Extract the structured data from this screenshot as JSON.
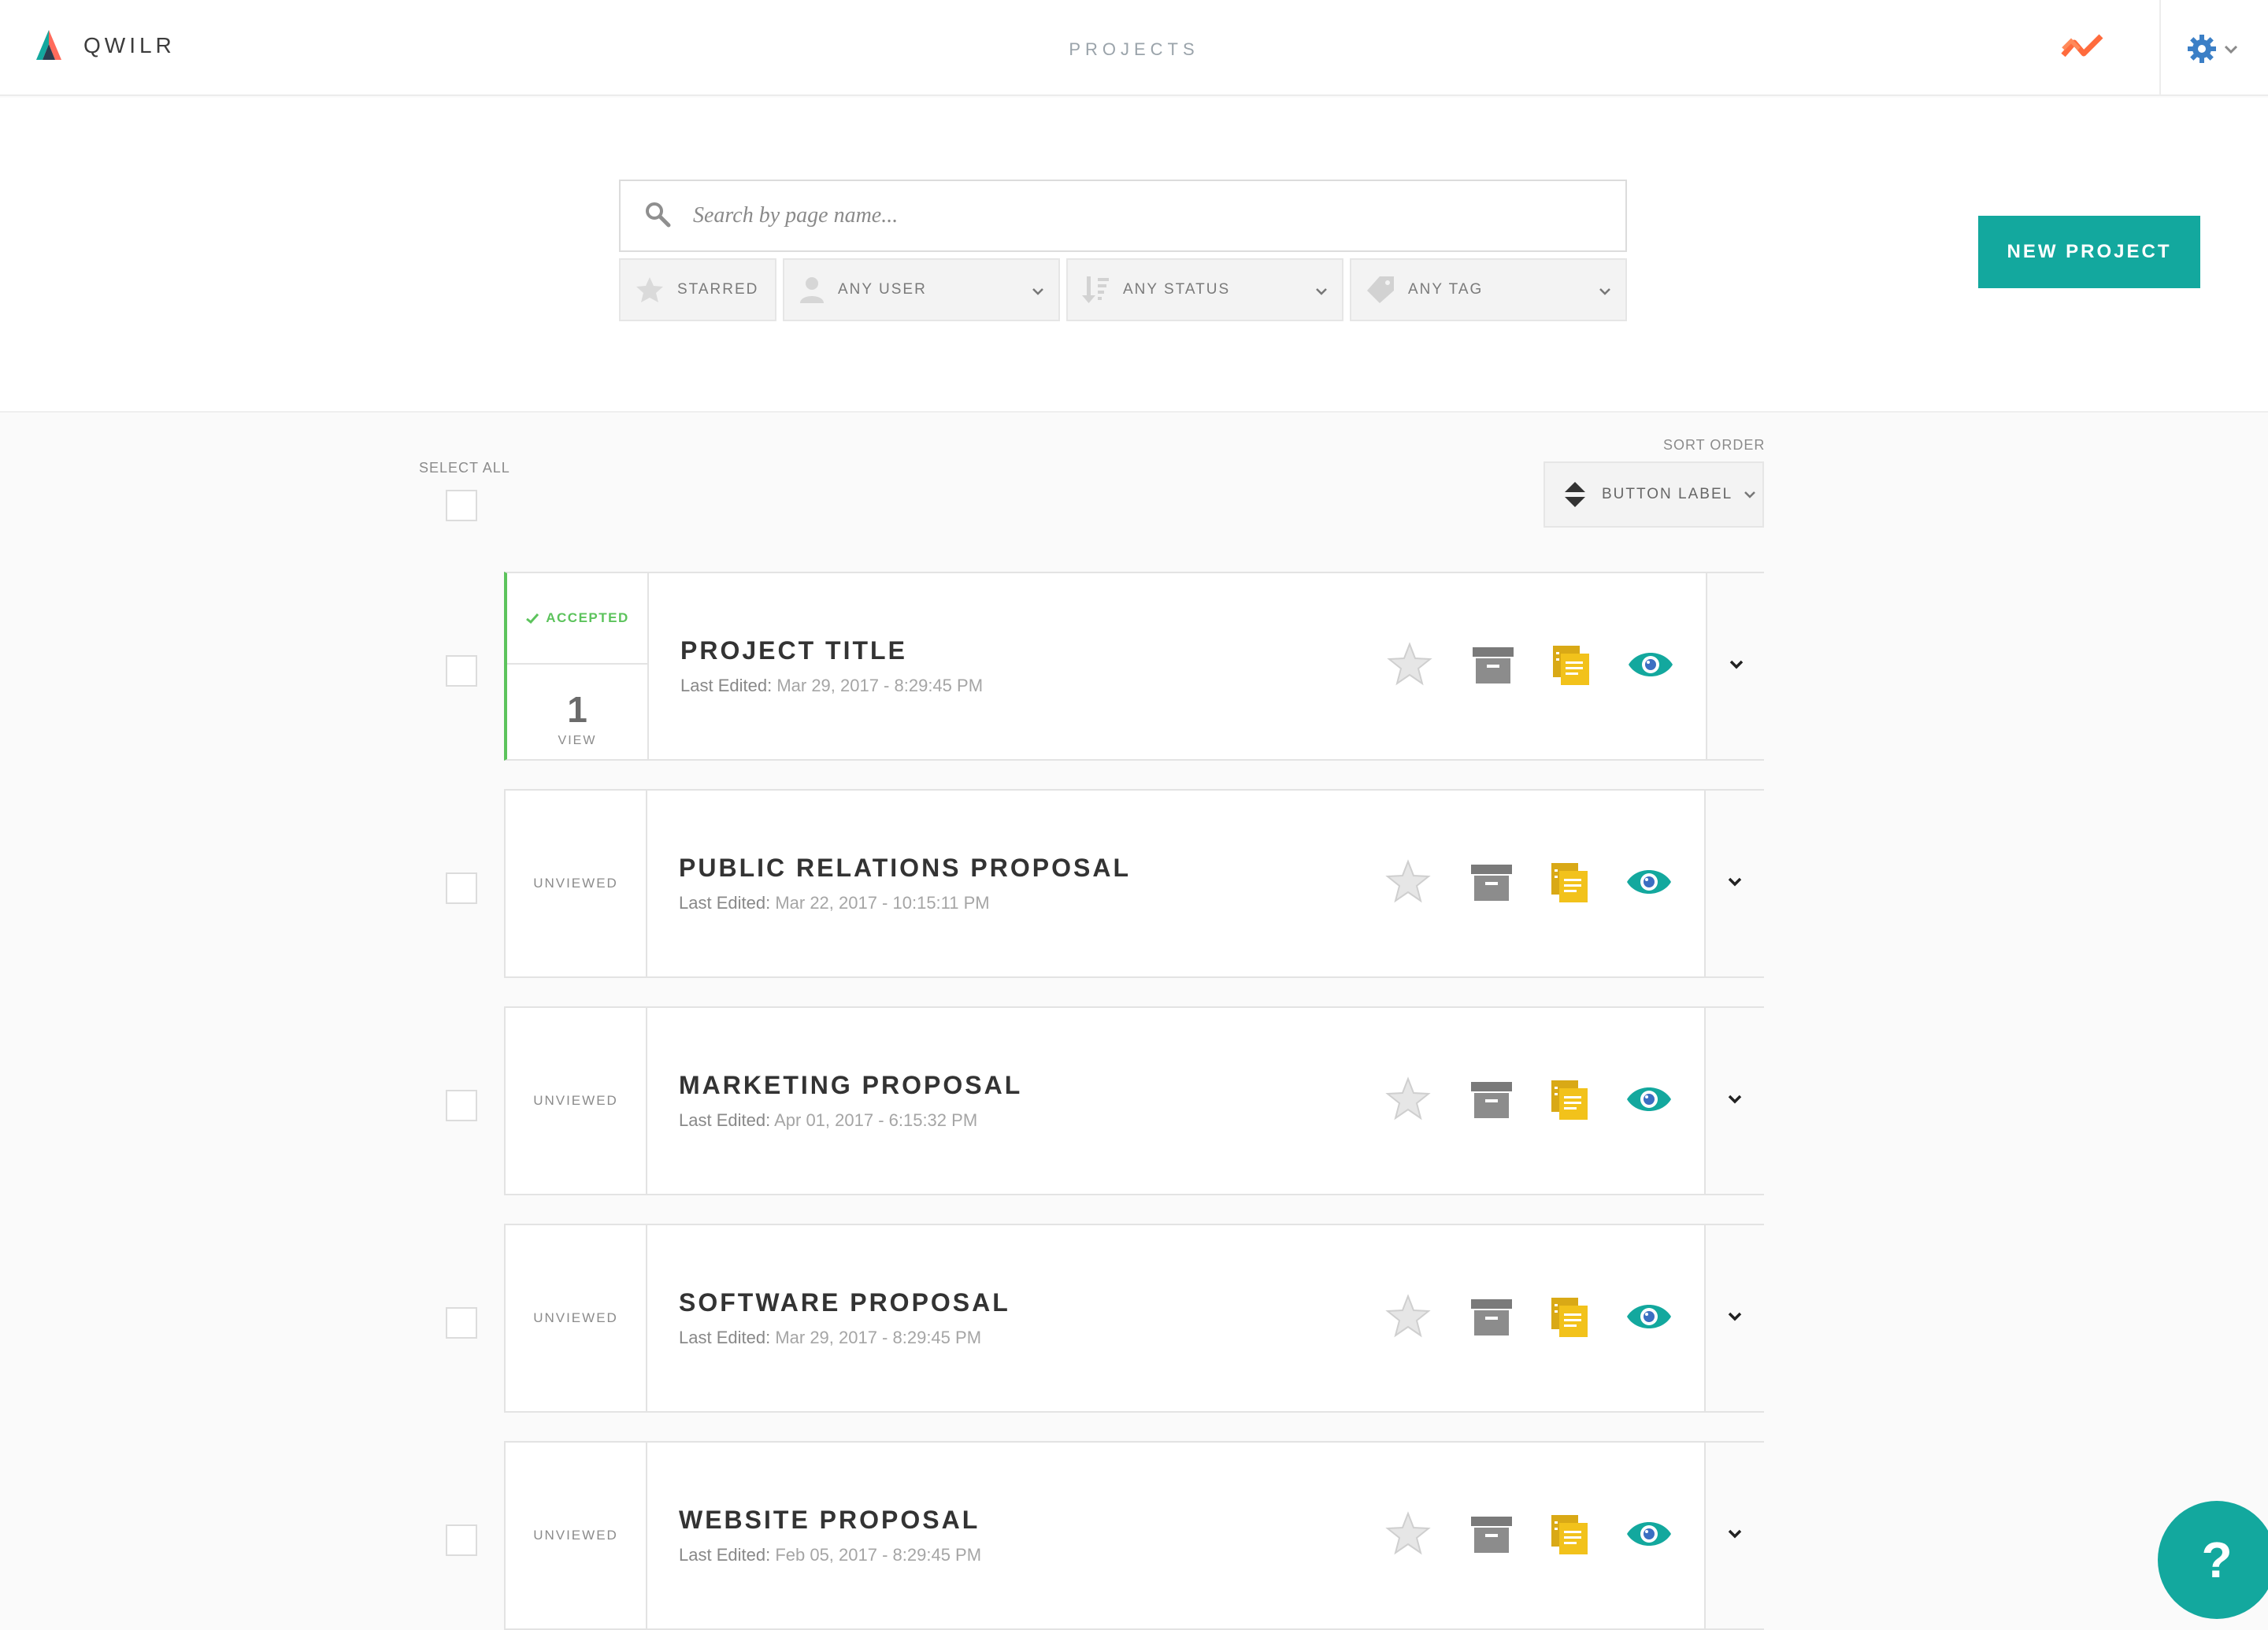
{
  "app": {
    "name": "QWILR",
    "page_title": "PROJECTS"
  },
  "header": {
    "activity_icon": "activity-icon",
    "settings_icon": "gear-icon"
  },
  "search": {
    "placeholder": "Search by page name..."
  },
  "filters": {
    "starred": "STARRED",
    "user": "ANY USER",
    "status": "ANY STATUS",
    "tag": "ANY TAG"
  },
  "new_project_label": "NEW PROJECT",
  "list": {
    "select_all": "SELECT ALL",
    "sort_order": "SORT ORDER",
    "sort_button": "BUTTON LABEL"
  },
  "projects": [
    {
      "status": "ACCEPTED",
      "views": "1",
      "views_label": "VIEW",
      "title": "PROJECT TITLE",
      "last_edited_label": "Last Edited:",
      "last_edited": "Mar 29, 2017 - 8:29:45 PM"
    },
    {
      "status": "UNVIEWED",
      "title": "PUBLIC RELATIONS PROPOSAL",
      "last_edited_label": "Last Edited:",
      "last_edited": "Mar 22, 2017 - 10:15:11 PM"
    },
    {
      "status": "UNVIEWED",
      "title": "MARKETING PROPOSAL",
      "last_edited_label": "Last Edited:",
      "last_edited": "Apr 01, 2017 - 6:15:32 PM"
    },
    {
      "status": "UNVIEWED",
      "title": "SOFTWARE PROPOSAL",
      "last_edited_label": "Last Edited:",
      "last_edited": "Mar 29, 2017 - 8:29:45 PM"
    },
    {
      "status": "UNVIEWED",
      "title": "WEBSITE PROPOSAL",
      "last_edited_label": "Last Edited:",
      "last_edited": "Feb 05, 2017 - 8:29:45 PM"
    }
  ],
  "help_label": "?",
  "colors": {
    "accent": "#13a89e",
    "accepted": "#5cc35c",
    "duplicate": "#f2c21b",
    "view": "#13a89e"
  }
}
